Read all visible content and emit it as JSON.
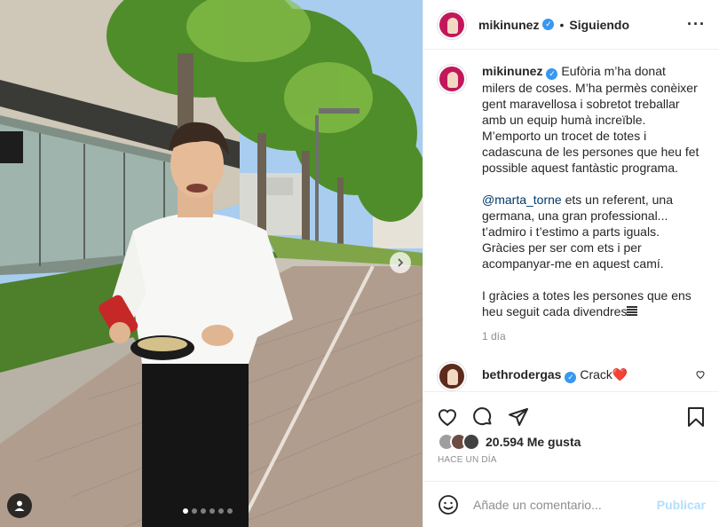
{
  "post": {
    "photo_alt": "",
    "carousel": {
      "count": 6,
      "active_index": 0
    }
  },
  "header": {
    "username": "mikinunez",
    "follow_label": "Siguiendo",
    "more_icon": "more-options-icon"
  },
  "caption": {
    "username": "mikinunez",
    "paragraph1": "Eufòria m’ha donat milers de coses. M’ha permès conèixer gent maravellosa i sobretot treballar amb un equip humà increïble. M’emporto un trocet de totes i cadascuna de les persones que heu fet possible aquest fantàstic programa.",
    "mention": "@marta_torne",
    "paragraph2_rest": " ets un referent, una germana, una gran professional... t’admiro i t’estimo a parts iguals. Gràcies per ser com ets i per acompanyar-me en aquest camí.",
    "paragraph3": "I gràcies a totes les persones que ens heu seguit cada divendres",
    "time": "1 día"
  },
  "comments": [
    {
      "username": "bethrodergas",
      "text": "Crack❤️"
    }
  ],
  "actions": {
    "like_icon": "heart-icon",
    "comment_icon": "comment-icon",
    "share_icon": "share-icon",
    "save_icon": "bookmark-icon"
  },
  "likes": {
    "count_text": "20.594 Me gusta"
  },
  "posted_ago": "HACE UN DÍA",
  "add_comment": {
    "placeholder": "Añade un comentario...",
    "publish_label": "Publicar"
  },
  "colors": {
    "verified": "#3897f0",
    "mention": "#00376b",
    "publish_disabled": "#b2dffc",
    "secondary_text": "#8e8e8e"
  }
}
